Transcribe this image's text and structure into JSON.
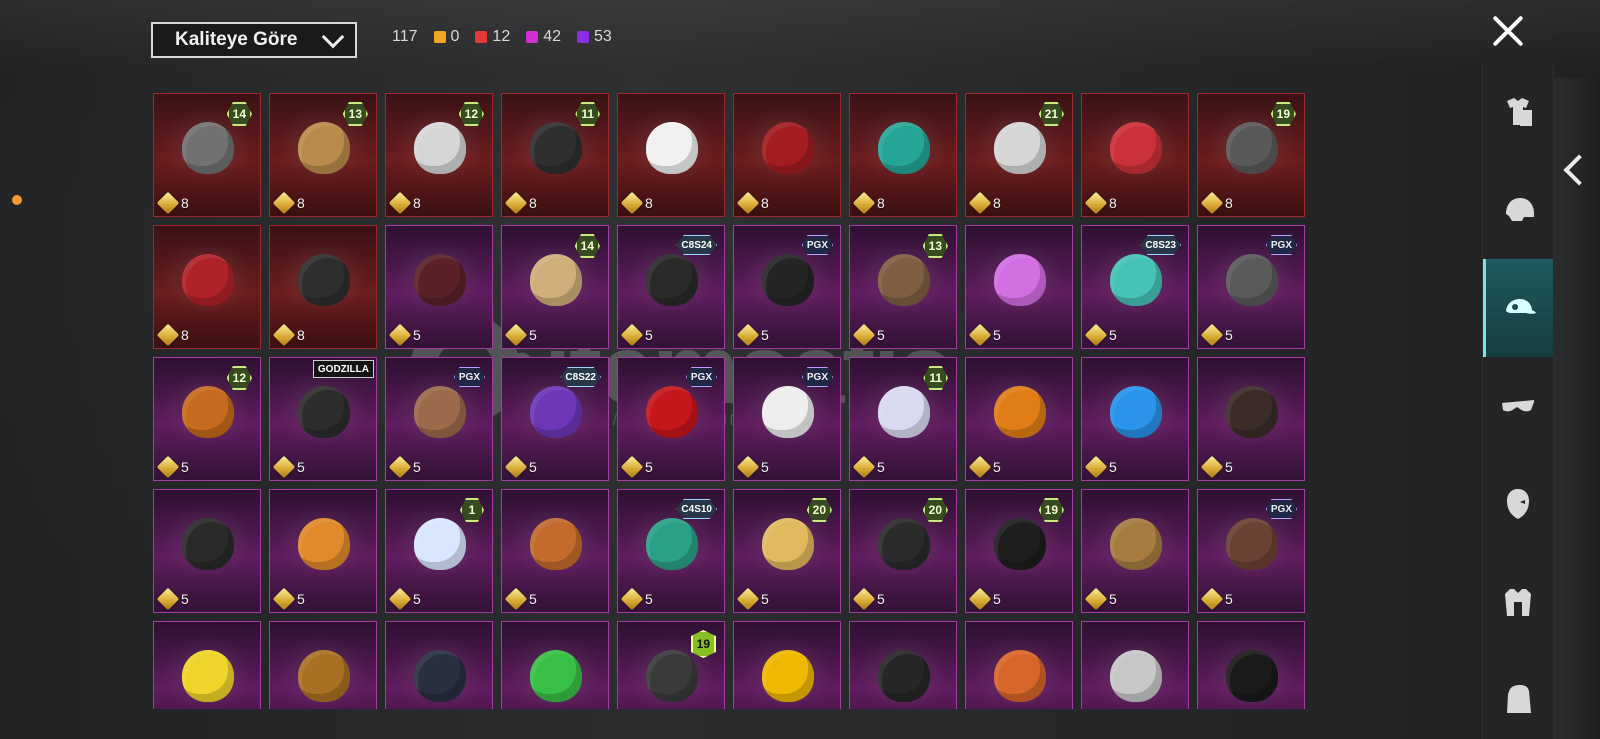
{
  "header": {
    "sort_label": "Kaliteye Göre",
    "total_count": "117",
    "counts": [
      {
        "label": "0",
        "color": "#f2a623"
      },
      {
        "label": "12",
        "color": "#e33937"
      },
      {
        "label": "42",
        "color": "#d42fd1"
      },
      {
        "label": "53",
        "color": "#8c2ee6"
      }
    ]
  },
  "watermark": {
    "brand": "itemsatis",
    "sub": "AD / SKIN / E-PIN .com"
  },
  "tabs": [
    {
      "name": "outfit-icon",
      "active": false
    },
    {
      "name": "helmet-icon",
      "active": false
    },
    {
      "name": "cap-icon",
      "active": true
    },
    {
      "name": "glasses-icon",
      "active": false
    },
    {
      "name": "mask-icon",
      "active": false
    },
    {
      "name": "jacket-icon",
      "active": false
    },
    {
      "name": "backpack-icon",
      "active": false
    }
  ],
  "items": [
    {
      "frame": "red",
      "value": "8",
      "badge": "14",
      "badge_type": "num",
      "color": "#717171"
    },
    {
      "frame": "red",
      "value": "8",
      "badge": "13",
      "badge_type": "num",
      "color": "#b98b4a"
    },
    {
      "frame": "red",
      "value": "8",
      "badge": "12",
      "badge_type": "num",
      "color": "#d6d6d6"
    },
    {
      "frame": "red",
      "value": "8",
      "badge": "11",
      "badge_type": "num",
      "color": "#2f2f2f"
    },
    {
      "frame": "red",
      "value": "8",
      "badge": "",
      "badge_type": "",
      "color": "#f1f1f1"
    },
    {
      "frame": "red",
      "value": "8",
      "badge": "",
      "badge_type": "",
      "color": "#a31d20"
    },
    {
      "frame": "red",
      "value": "8",
      "badge": "",
      "badge_type": "",
      "color": "#26a597"
    },
    {
      "frame": "red",
      "value": "8",
      "badge": "21",
      "badge_type": "num",
      "color": "#d6d6d6"
    },
    {
      "frame": "red",
      "value": "8",
      "badge": "",
      "badge_type": "",
      "color": "#cb3138"
    },
    {
      "frame": "red",
      "value": "8",
      "badge": "19",
      "badge_type": "num",
      "color": "#595959"
    },
    {
      "frame": "red",
      "value": "8",
      "badge": "",
      "badge_type": "",
      "color": "#b02228"
    },
    {
      "frame": "red",
      "value": "8",
      "badge": "",
      "badge_type": "",
      "color": "#2e2e2e"
    },
    {
      "frame": "purple",
      "value": "5",
      "badge": "",
      "badge_type": "",
      "color": "#5a2228"
    },
    {
      "frame": "purple",
      "value": "5",
      "badge": "14",
      "badge_type": "num",
      "color": "#cfae7b"
    },
    {
      "frame": "purple",
      "value": "5",
      "badge": "C8S24",
      "badge_type": "text",
      "color": "#2a2a2a"
    },
    {
      "frame": "purple",
      "value": "5",
      "badge": "PGX",
      "badge_type": "pgx",
      "color": "#252525"
    },
    {
      "frame": "purple",
      "value": "5",
      "badge": "13",
      "badge_type": "num",
      "color": "#7f5e42"
    },
    {
      "frame": "purple",
      "value": "5",
      "badge": "",
      "badge_type": "",
      "color": "#d36ee3"
    },
    {
      "frame": "purple",
      "value": "5",
      "badge": "C8S23",
      "badge_type": "text",
      "color": "#46c3b6"
    },
    {
      "frame": "purple",
      "value": "5",
      "badge": "PGX",
      "badge_type": "pgx",
      "color": "#5a5a5a"
    },
    {
      "frame": "purple",
      "value": "5",
      "badge": "12",
      "badge_type": "num",
      "color": "#c66b1d"
    },
    {
      "frame": "purple",
      "value": "5",
      "badge": "GODZILLA",
      "badge_type": "godzilla",
      "color": "#2d2d2d"
    },
    {
      "frame": "purple",
      "value": "5",
      "badge": "PGX",
      "badge_type": "pgx",
      "color": "#9b6a4b"
    },
    {
      "frame": "purple",
      "value": "5",
      "badge": "C8S22",
      "badge_type": "text",
      "color": "#6d37b7"
    },
    {
      "frame": "purple",
      "value": "5",
      "badge": "PGX",
      "badge_type": "pgx",
      "color": "#c5161b"
    },
    {
      "frame": "purple",
      "value": "5",
      "badge": "PGX",
      "badge_type": "pgx",
      "color": "#eeeeee"
    },
    {
      "frame": "purple",
      "value": "5",
      "badge": "11",
      "badge_type": "num",
      "color": "#d9d9ef"
    },
    {
      "frame": "purple",
      "value": "5",
      "badge": "",
      "badge_type": "",
      "color": "#e07d16"
    },
    {
      "frame": "purple",
      "value": "5",
      "badge": "",
      "badge_type": "",
      "color": "#2a93ea"
    },
    {
      "frame": "purple",
      "value": "5",
      "badge": "",
      "badge_type": "",
      "color": "#3b2c28"
    },
    {
      "frame": "purple",
      "value": "5",
      "badge": "",
      "badge_type": "",
      "color": "#2a2a2a"
    },
    {
      "frame": "purple",
      "value": "5",
      "badge": "",
      "badge_type": "",
      "color": "#e08a2b"
    },
    {
      "frame": "purple",
      "value": "5",
      "badge": "1",
      "badge_type": "num",
      "color": "#d8e6ff"
    },
    {
      "frame": "purple",
      "value": "5",
      "badge": "",
      "badge_type": "",
      "color": "#c26b2d"
    },
    {
      "frame": "purple",
      "value": "5",
      "badge": "C4S10",
      "badge_type": "text",
      "color": "#2aa186"
    },
    {
      "frame": "purple",
      "value": "5",
      "badge": "20",
      "badge_type": "num",
      "color": "#e1b95f"
    },
    {
      "frame": "purple",
      "value": "5",
      "badge": "20",
      "badge_type": "num",
      "color": "#2b2b2b"
    },
    {
      "frame": "purple",
      "value": "5",
      "badge": "19",
      "badge_type": "num",
      "color": "#1e1e1e"
    },
    {
      "frame": "purple",
      "value": "5",
      "badge": "",
      "badge_type": "",
      "color": "#a77c41"
    },
    {
      "frame": "purple",
      "value": "5",
      "badge": "PGX",
      "badge_type": "pgx",
      "color": "#6b4134"
    },
    {
      "frame": "purple",
      "value": "",
      "badge": "",
      "badge_type": "",
      "color": "#efd52a"
    },
    {
      "frame": "purple",
      "value": "",
      "badge": "",
      "badge_type": "",
      "color": "#a97024"
    },
    {
      "frame": "purple",
      "value": "",
      "badge": "",
      "badge_type": "",
      "color": "#2a2f40"
    },
    {
      "frame": "purple",
      "value": "",
      "badge": "",
      "badge_type": "",
      "color": "#37bf46"
    },
    {
      "frame": "purple",
      "value": "",
      "badge": "19",
      "badge_type": "yellow19",
      "color": "#3a3a3a"
    },
    {
      "frame": "purple",
      "value": "",
      "badge": "",
      "badge_type": "",
      "color": "#f0b800"
    },
    {
      "frame": "purple",
      "value": "",
      "badge": "",
      "badge_type": "",
      "color": "#262626"
    },
    {
      "frame": "purple",
      "value": "",
      "badge": "",
      "badge_type": "",
      "color": "#d7662a"
    },
    {
      "frame": "purple",
      "value": "",
      "badge": "",
      "badge_type": "",
      "color": "#c7c7c7"
    },
    {
      "frame": "purple",
      "value": "",
      "badge": "",
      "badge_type": "",
      "color": "#1a1a1a"
    }
  ]
}
